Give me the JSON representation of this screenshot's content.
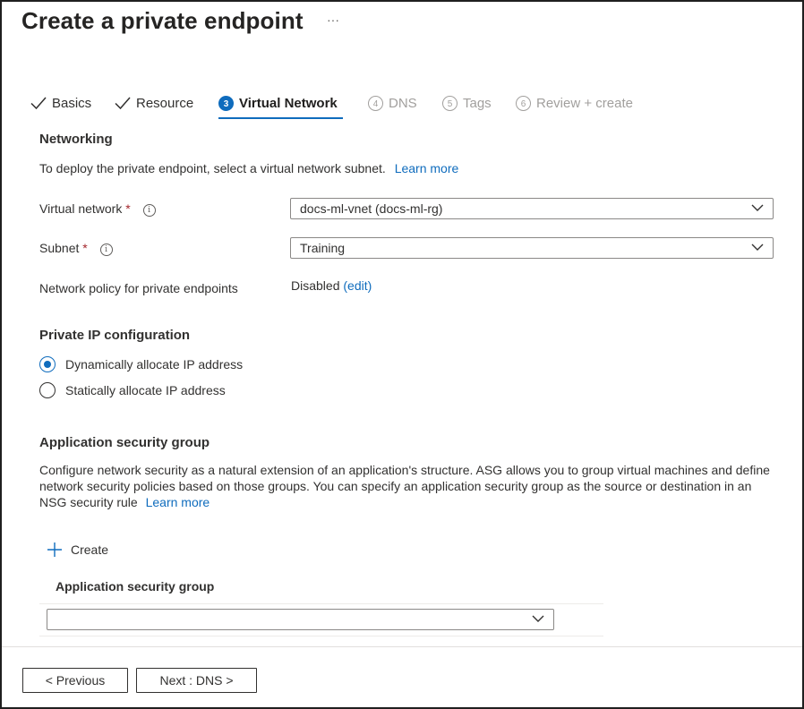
{
  "page": {
    "title": "Create a private endpoint",
    "more": "···"
  },
  "tabs": [
    {
      "label": "Basics",
      "state": "completed"
    },
    {
      "label": "Resource",
      "state": "completed"
    },
    {
      "number": "3",
      "label": "Virtual Network",
      "state": "active"
    },
    {
      "number": "4",
      "label": "DNS",
      "state": "disabled"
    },
    {
      "number": "5",
      "label": "Tags",
      "state": "disabled"
    },
    {
      "number": "6",
      "label": "Review + create",
      "state": "disabled"
    }
  ],
  "networking": {
    "heading": "Networking",
    "description": "To deploy the private endpoint, select a virtual network subnet.",
    "learn_more": "Learn more",
    "virtual_network_label": "Virtual network",
    "virtual_network_value": "docs-ml-vnet (docs-ml-rg)",
    "subnet_label": "Subnet",
    "subnet_value": "Training",
    "required_mark": "*",
    "info_glyph": "i",
    "policy_label": "Network policy for private endpoints",
    "policy_value": "Disabled",
    "policy_edit": "(edit)"
  },
  "ip_config": {
    "heading": "Private IP configuration",
    "options": [
      {
        "label": "Dynamically allocate IP address",
        "selected": true
      },
      {
        "label": "Statically allocate IP address",
        "selected": false
      }
    ]
  },
  "asg": {
    "heading": "Application security group",
    "description": "Configure network security as a natural extension of an application's structure. ASG allows you to group virtual machines and define network security policies based on those groups. You can specify an application security group as the source or destination in an NSG security rule",
    "learn_more": "Learn more",
    "create_label": "Create",
    "column_header": "Application security group",
    "select_value": ""
  },
  "footer": {
    "previous": "< Previous",
    "next": "Next : DNS >"
  },
  "colors": {
    "accent": "#0f6cbd",
    "required": "#a4262c",
    "text": "#323130",
    "disabled": "#a19f9d"
  }
}
